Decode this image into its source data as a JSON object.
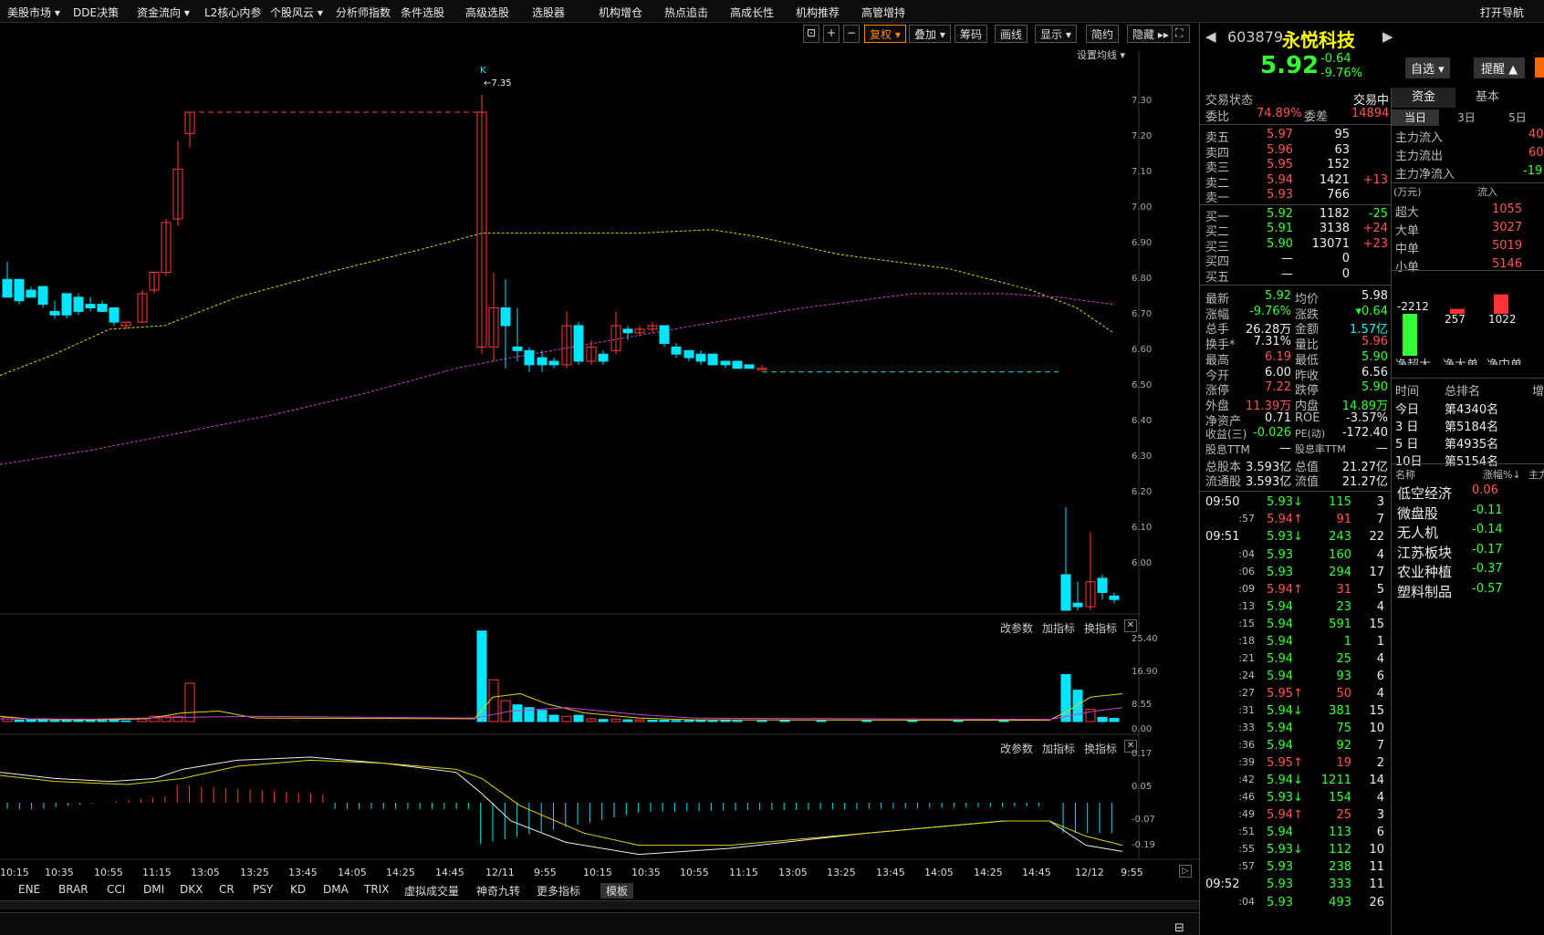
{
  "menu": [
    "美股市场 ▾",
    "DDE决策",
    "资金流向 ▾",
    "L2核心内参",
    "个股风云 ▾",
    "分析师指数",
    "条件选股",
    "高级选股",
    "选股器",
    "机构增仓",
    "热点追击",
    "高成长性",
    "机构推荐",
    "高管增持",
    "打开导航"
  ],
  "toolbar": {
    "fuquan": "复权 ▾",
    "diejia": "叠加 ▾",
    "choumao": "筹码",
    "huaxian": "画线",
    "xianshi": "显示 ▾",
    "jianyue": "简约",
    "yincang": "隐藏 ▸▸",
    "set_ma": "设置均线 ▾"
  },
  "chart_annot": {
    "k_marker": "K",
    "high_label": "←7.35"
  },
  "price_axis": [
    "7.30",
    "7.20",
    "7.10",
    "7.00",
    "6.90",
    "6.80",
    "6.70",
    "6.60",
    "6.50",
    "6.40",
    "6.30",
    "6.20",
    "6.10",
    "6.00"
  ],
  "vol_axis": [
    "25.40",
    "16.90",
    "8.55",
    "0.00"
  ],
  "macd_axis": [
    "0.17",
    "0.05",
    "-0.07",
    "-0.19"
  ],
  "panel_links": {
    "gai": "改参数",
    "jia": "加指标",
    "huan": "换指标"
  },
  "time_axis": [
    "10:15",
    "10:35",
    "10:55",
    "11:15",
    "13:05",
    "13:25",
    "13:45",
    "14:05",
    "14:25",
    "14:45",
    "12/11",
    "9:55",
    "10:15",
    "10:35",
    "10:55",
    "11:15",
    "13:05",
    "13:25",
    "13:45",
    "14:05",
    "14:25",
    "14:45",
    "12/12",
    "9:55"
  ],
  "bottom_tabs": [
    "ENE",
    "BRAR",
    "CCI",
    "DMI",
    "DKX",
    "CR",
    "PSY",
    "KD",
    "DMA",
    "TRIX",
    "虚拟成交量",
    "神奇九转",
    "更多指标",
    "模板"
  ],
  "stock": {
    "code": "603879",
    "name": "永悦科技",
    "price": "5.92",
    "change": "-0.64",
    "pct": "-9.76%",
    "btn_zixuan": "自选 ▾",
    "btn_tixing": "提醒 ▲"
  },
  "status": {
    "label": "交易状态",
    "value": "交易中",
    "weibi_l": "委比",
    "weibi": "74.89%",
    "weicha_l": "委差",
    "weicha": "14894"
  },
  "sells": [
    {
      "l": "卖五",
      "p": "5.97",
      "v": "95",
      "d": ""
    },
    {
      "l": "卖四",
      "p": "5.96",
      "v": "63",
      "d": ""
    },
    {
      "l": "卖三",
      "p": "5.95",
      "v": "152",
      "d": ""
    },
    {
      "l": "卖二",
      "p": "5.94",
      "v": "1421",
      "d": "+13"
    },
    {
      "l": "卖一",
      "p": "5.93",
      "v": "766",
      "d": ""
    }
  ],
  "buys": [
    {
      "l": "买一",
      "p": "5.92",
      "v": "1182",
      "d": "-25"
    },
    {
      "l": "买二",
      "p": "5.91",
      "v": "3138",
      "d": "+24"
    },
    {
      "l": "买三",
      "p": "5.90",
      "v": "13071",
      "d": "+23"
    },
    {
      "l": "买四",
      "p": "—",
      "v": "0",
      "d": ""
    },
    {
      "l": "买五",
      "p": "—",
      "v": "0",
      "d": ""
    }
  ],
  "stats": [
    {
      "a": "最新",
      "av": "5.92",
      "b": "均价",
      "bv": "5.98"
    },
    {
      "a": "涨幅",
      "av": "-9.76%",
      "b": "涨跌",
      "bv": "▾0.64"
    },
    {
      "a": "总手",
      "av": "26.28万",
      "b": "金额",
      "bv": "1.57亿"
    },
    {
      "a": "换手*",
      "av": "7.31%",
      "b": "量比",
      "bv": "5.96"
    },
    {
      "a": "最高",
      "av": "6.19",
      "b": "最低",
      "bv": "5.90"
    },
    {
      "a": "今开",
      "av": "6.00",
      "b": "昨收",
      "bv": "6.56"
    },
    {
      "a": "涨停",
      "av": "7.22",
      "b": "跌停",
      "bv": "5.90"
    },
    {
      "a": "外盘",
      "av": "11.39万",
      "b": "内盘",
      "bv": "14.89万"
    },
    {
      "a": "净资产",
      "av": "0.71",
      "b": "ROE",
      "bv": "-3.57%"
    },
    {
      "a": "收益(三)",
      "av": "-0.026",
      "b": "PE(动)",
      "bv": "-172.40"
    },
    {
      "a": "股息TTM",
      "av": "—",
      "b": "股息率TTM",
      "bv": "—"
    },
    {
      "a": "总股本",
      "av": "3.593亿",
      "b": "总值",
      "bv": "21.27亿"
    },
    {
      "a": "流通股",
      "av": "3.593亿",
      "b": "流值",
      "bv": "21.27亿"
    }
  ],
  "ticks": [
    {
      "t": "09:50",
      "p": "5.93",
      "ar": "↓",
      "v": "115",
      "n": "3"
    },
    {
      "t": ":57",
      "p": "5.94",
      "ar": "↑",
      "v": "91",
      "n": "7"
    },
    {
      "t": "09:51",
      "p": "5.93",
      "ar": "↓",
      "v": "243",
      "n": "22"
    },
    {
      "t": ":04",
      "p": "5.93",
      "ar": "",
      "v": "160",
      "n": "4"
    },
    {
      "t": ":06",
      "p": "5.93",
      "ar": "",
      "v": "294",
      "n": "17"
    },
    {
      "t": ":09",
      "p": "5.94",
      "ar": "↑",
      "v": "31",
      "n": "5"
    },
    {
      "t": ":13",
      "p": "5.94",
      "ar": "",
      "v": "23",
      "n": "4"
    },
    {
      "t": ":15",
      "p": "5.94",
      "ar": "",
      "v": "591",
      "n": "15"
    },
    {
      "t": ":18",
      "p": "5.94",
      "ar": "",
      "v": "1",
      "n": "1"
    },
    {
      "t": ":21",
      "p": "5.94",
      "ar": "",
      "v": "25",
      "n": "4"
    },
    {
      "t": ":24",
      "p": "5.94",
      "ar": "",
      "v": "93",
      "n": "6"
    },
    {
      "t": ":27",
      "p": "5.95",
      "ar": "↑",
      "v": "50",
      "n": "4"
    },
    {
      "t": ":31",
      "p": "5.94",
      "ar": "↓",
      "v": "381",
      "n": "15"
    },
    {
      "t": ":33",
      "p": "5.94",
      "ar": "",
      "v": "75",
      "n": "10"
    },
    {
      "t": ":36",
      "p": "5.94",
      "ar": "",
      "v": "92",
      "n": "7"
    },
    {
      "t": ":39",
      "p": "5.95",
      "ar": "↑",
      "v": "19",
      "n": "2"
    },
    {
      "t": ":42",
      "p": "5.94",
      "ar": "↓",
      "v": "1211",
      "n": "14"
    },
    {
      "t": ":46",
      "p": "5.93",
      "ar": "↓",
      "v": "154",
      "n": "4"
    },
    {
      "t": ":49",
      "p": "5.94",
      "ar": "↑",
      "v": "25",
      "n": "3"
    },
    {
      "t": ":51",
      "p": "5.94",
      "ar": "",
      "v": "113",
      "n": "6"
    },
    {
      "t": ":55",
      "p": "5.93",
      "ar": "↓",
      "v": "112",
      "n": "10"
    },
    {
      "t": ":57",
      "p": "5.93",
      "ar": "",
      "v": "238",
      "n": "11"
    },
    {
      "t": "09:52",
      "p": "5.93",
      "ar": "",
      "v": "333",
      "n": "11"
    },
    {
      "t": ":04",
      "p": "5.93",
      "ar": "",
      "v": "493",
      "n": "26"
    }
  ],
  "fund": {
    "tab1": "资金",
    "tab2": "基本",
    "sub1": "当日",
    "sub2": "3日",
    "sub3": "5日",
    "in_l": "主力流入",
    "in_v": "40",
    "out_l": "主力流出",
    "out_v": "60",
    "net_l": "主力净流入",
    "net_v": "-19",
    "unit": "(万元)",
    "flow": "流入",
    "rows": [
      {
        "l": "超大",
        "v": "1055"
      },
      {
        "l": "大单",
        "v": "3027"
      },
      {
        "l": "中单",
        "v": "5019"
      },
      {
        "l": "小单",
        "v": "5146"
      }
    ],
    "bars": [
      {
        "l": "净超大",
        "v": "-2212"
      },
      {
        "l": "净大单",
        "v": "257"
      },
      {
        "l": "净中单",
        "v": "1022"
      }
    ],
    "rank_h": [
      "时间",
      "总排名",
      "增"
    ],
    "ranks": [
      {
        "t": "今日",
        "r": "第4340名"
      },
      {
        "t": "3 日",
        "r": "第5184名"
      },
      {
        "t": "5 日",
        "r": "第4935名"
      },
      {
        "t": "10日",
        "r": "第5154名"
      }
    ],
    "sect_h": [
      "名称",
      "涨幅%↓",
      "主力"
    ],
    "sectors": [
      {
        "n": "低空经济",
        "p": "0.06"
      },
      {
        "n": "微盘股",
        "p": "-0.11"
      },
      {
        "n": "无人机",
        "p": "-0.14"
      },
      {
        "n": "江苏板块",
        "p": "-0.17"
      },
      {
        "n": "农业种植",
        "p": "-0.37"
      },
      {
        "n": "塑料制品",
        "p": "-0.57"
      }
    ]
  }
}
